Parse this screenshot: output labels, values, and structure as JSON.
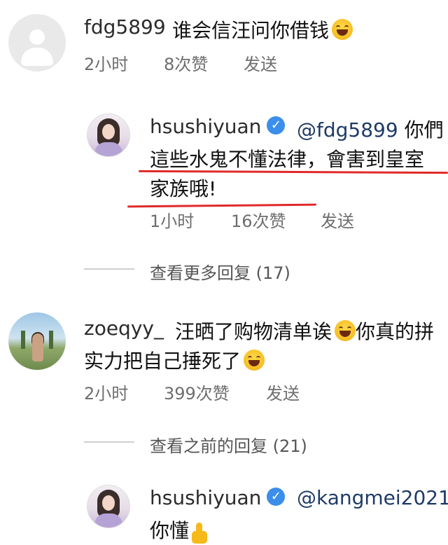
{
  "comments": [
    {
      "username": "fdg5899",
      "text": "谁会信汪问你借钱",
      "emoji": "laughing-tears-emoji",
      "time": "2小时",
      "likes": "8次赞",
      "reply": "发送"
    },
    {
      "username": "hsushiyuan",
      "verified": true,
      "mention": "@fdg5899",
      "text_line1": "你們",
      "text_line2": "這些水鬼不懂法律，會害到皇室",
      "text_line3": "家族哦!",
      "time": "1小时",
      "likes": "16次赞",
      "reply": "发送"
    },
    {
      "more_replies": "查看更多回复 (17)"
    },
    {
      "username": "zoeqyy_",
      "text_line1": "汪晒了购物清单诶",
      "text_line1b": "你真的拼",
      "text_line2": "实力把自己捶死了",
      "emoji": "sweat-smile-emoji",
      "time": "2小时",
      "likes": "399次赞",
      "reply": "发送"
    },
    {
      "previous_replies": "查看之前的回复 (21)"
    },
    {
      "username": "hsushiyuan",
      "verified": true,
      "mention": "@kangmei2021",
      "text_line2": "你懂",
      "emoji": "thumbs-up-emoji"
    }
  ],
  "colors": {
    "underline": "#e02a2a",
    "verified_badge": "#3b8eea"
  }
}
